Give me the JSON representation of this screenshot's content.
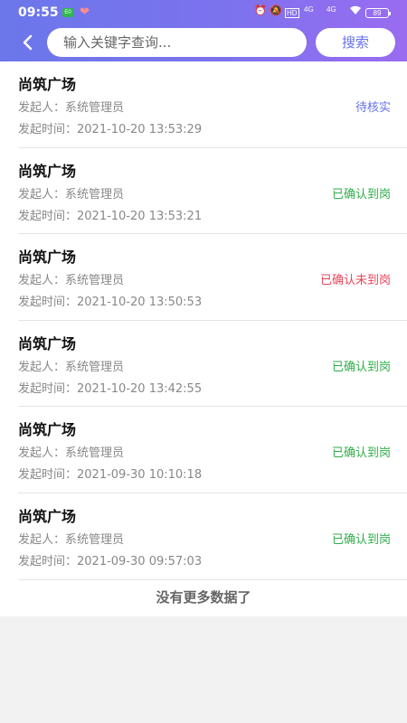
{
  "statusbar": {
    "time": "09:55",
    "notif_badge": "E0",
    "signal_label_1": "HD",
    "net_1": "4G",
    "net_2": "4G",
    "battery": "89"
  },
  "header": {
    "search_placeholder": "输入关键字查询...",
    "search_button": "搜索"
  },
  "colors": {
    "pending": "#6472e8",
    "confirmed_on_duty": "#2fae4a",
    "confirmed_absent": "#e8465a"
  },
  "list": {
    "initiator_label": "发起人：",
    "time_label": "发起时间：",
    "items": [
      {
        "title": "尚筑广场",
        "initiator": "系统管理员",
        "time": "2021-10-20 13:53:29",
        "status": "待核实",
        "status_color": "#6472e8"
      },
      {
        "title": "尚筑广场",
        "initiator": "系统管理员",
        "time": "2021-10-20 13:53:21",
        "status": "已确认到岗",
        "status_color": "#2fae4a"
      },
      {
        "title": "尚筑广场",
        "initiator": "系统管理员",
        "time": "2021-10-20 13:50:53",
        "status": "已确认未到岗",
        "status_color": "#e8465a"
      },
      {
        "title": "尚筑广场",
        "initiator": "系统管理员",
        "time": "2021-10-20 13:42:55",
        "status": "已确认到岗",
        "status_color": "#2fae4a"
      },
      {
        "title": "尚筑广场",
        "initiator": "系统管理员",
        "time": "2021-09-30 10:10:18",
        "status": "已确认到岗",
        "status_color": "#2fae4a"
      },
      {
        "title": "尚筑广场",
        "initiator": "系统管理员",
        "time": "2021-09-30 09:57:03",
        "status": "已确认到岗",
        "status_color": "#2fae4a"
      }
    ],
    "footer": "没有更多数据了"
  }
}
